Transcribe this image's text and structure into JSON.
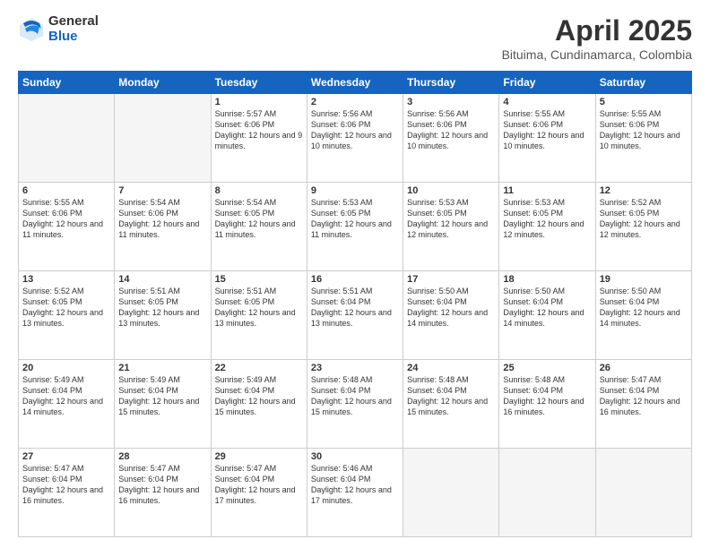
{
  "header": {
    "logo": {
      "general": "General",
      "blue": "Blue"
    },
    "title": "April 2025",
    "location": "Bituima, Cundinamarca, Colombia"
  },
  "weekdays": [
    "Sunday",
    "Monday",
    "Tuesday",
    "Wednesday",
    "Thursday",
    "Friday",
    "Saturday"
  ],
  "weeks": [
    [
      {
        "day": "",
        "empty": true
      },
      {
        "day": "",
        "empty": true
      },
      {
        "day": "1",
        "sunrise": "Sunrise: 5:57 AM",
        "sunset": "Sunset: 6:06 PM",
        "daylight": "Daylight: 12 hours and 9 minutes."
      },
      {
        "day": "2",
        "sunrise": "Sunrise: 5:56 AM",
        "sunset": "Sunset: 6:06 PM",
        "daylight": "Daylight: 12 hours and 10 minutes."
      },
      {
        "day": "3",
        "sunrise": "Sunrise: 5:56 AM",
        "sunset": "Sunset: 6:06 PM",
        "daylight": "Daylight: 12 hours and 10 minutes."
      },
      {
        "day": "4",
        "sunrise": "Sunrise: 5:55 AM",
        "sunset": "Sunset: 6:06 PM",
        "daylight": "Daylight: 12 hours and 10 minutes."
      },
      {
        "day": "5",
        "sunrise": "Sunrise: 5:55 AM",
        "sunset": "Sunset: 6:06 PM",
        "daylight": "Daylight: 12 hours and 10 minutes."
      }
    ],
    [
      {
        "day": "6",
        "sunrise": "Sunrise: 5:55 AM",
        "sunset": "Sunset: 6:06 PM",
        "daylight": "Daylight: 12 hours and 11 minutes."
      },
      {
        "day": "7",
        "sunrise": "Sunrise: 5:54 AM",
        "sunset": "Sunset: 6:06 PM",
        "daylight": "Daylight: 12 hours and 11 minutes."
      },
      {
        "day": "8",
        "sunrise": "Sunrise: 5:54 AM",
        "sunset": "Sunset: 6:05 PM",
        "daylight": "Daylight: 12 hours and 11 minutes."
      },
      {
        "day": "9",
        "sunrise": "Sunrise: 5:53 AM",
        "sunset": "Sunset: 6:05 PM",
        "daylight": "Daylight: 12 hours and 11 minutes."
      },
      {
        "day": "10",
        "sunrise": "Sunrise: 5:53 AM",
        "sunset": "Sunset: 6:05 PM",
        "daylight": "Daylight: 12 hours and 12 minutes."
      },
      {
        "day": "11",
        "sunrise": "Sunrise: 5:53 AM",
        "sunset": "Sunset: 6:05 PM",
        "daylight": "Daylight: 12 hours and 12 minutes."
      },
      {
        "day": "12",
        "sunrise": "Sunrise: 5:52 AM",
        "sunset": "Sunset: 6:05 PM",
        "daylight": "Daylight: 12 hours and 12 minutes."
      }
    ],
    [
      {
        "day": "13",
        "sunrise": "Sunrise: 5:52 AM",
        "sunset": "Sunset: 6:05 PM",
        "daylight": "Daylight: 12 hours and 13 minutes."
      },
      {
        "day": "14",
        "sunrise": "Sunrise: 5:51 AM",
        "sunset": "Sunset: 6:05 PM",
        "daylight": "Daylight: 12 hours and 13 minutes."
      },
      {
        "day": "15",
        "sunrise": "Sunrise: 5:51 AM",
        "sunset": "Sunset: 6:05 PM",
        "daylight": "Daylight: 12 hours and 13 minutes."
      },
      {
        "day": "16",
        "sunrise": "Sunrise: 5:51 AM",
        "sunset": "Sunset: 6:04 PM",
        "daylight": "Daylight: 12 hours and 13 minutes."
      },
      {
        "day": "17",
        "sunrise": "Sunrise: 5:50 AM",
        "sunset": "Sunset: 6:04 PM",
        "daylight": "Daylight: 12 hours and 14 minutes."
      },
      {
        "day": "18",
        "sunrise": "Sunrise: 5:50 AM",
        "sunset": "Sunset: 6:04 PM",
        "daylight": "Daylight: 12 hours and 14 minutes."
      },
      {
        "day": "19",
        "sunrise": "Sunrise: 5:50 AM",
        "sunset": "Sunset: 6:04 PM",
        "daylight": "Daylight: 12 hours and 14 minutes."
      }
    ],
    [
      {
        "day": "20",
        "sunrise": "Sunrise: 5:49 AM",
        "sunset": "Sunset: 6:04 PM",
        "daylight": "Daylight: 12 hours and 14 minutes."
      },
      {
        "day": "21",
        "sunrise": "Sunrise: 5:49 AM",
        "sunset": "Sunset: 6:04 PM",
        "daylight": "Daylight: 12 hours and 15 minutes."
      },
      {
        "day": "22",
        "sunrise": "Sunrise: 5:49 AM",
        "sunset": "Sunset: 6:04 PM",
        "daylight": "Daylight: 12 hours and 15 minutes."
      },
      {
        "day": "23",
        "sunrise": "Sunrise: 5:48 AM",
        "sunset": "Sunset: 6:04 PM",
        "daylight": "Daylight: 12 hours and 15 minutes."
      },
      {
        "day": "24",
        "sunrise": "Sunrise: 5:48 AM",
        "sunset": "Sunset: 6:04 PM",
        "daylight": "Daylight: 12 hours and 15 minutes."
      },
      {
        "day": "25",
        "sunrise": "Sunrise: 5:48 AM",
        "sunset": "Sunset: 6:04 PM",
        "daylight": "Daylight: 12 hours and 16 minutes."
      },
      {
        "day": "26",
        "sunrise": "Sunrise: 5:47 AM",
        "sunset": "Sunset: 6:04 PM",
        "daylight": "Daylight: 12 hours and 16 minutes."
      }
    ],
    [
      {
        "day": "27",
        "sunrise": "Sunrise: 5:47 AM",
        "sunset": "Sunset: 6:04 PM",
        "daylight": "Daylight: 12 hours and 16 minutes."
      },
      {
        "day": "28",
        "sunrise": "Sunrise: 5:47 AM",
        "sunset": "Sunset: 6:04 PM",
        "daylight": "Daylight: 12 hours and 16 minutes."
      },
      {
        "day": "29",
        "sunrise": "Sunrise: 5:47 AM",
        "sunset": "Sunset: 6:04 PM",
        "daylight": "Daylight: 12 hours and 17 minutes."
      },
      {
        "day": "30",
        "sunrise": "Sunrise: 5:46 AM",
        "sunset": "Sunset: 6:04 PM",
        "daylight": "Daylight: 12 hours and 17 minutes."
      },
      {
        "day": "",
        "empty": true
      },
      {
        "day": "",
        "empty": true
      },
      {
        "day": "",
        "empty": true
      }
    ]
  ]
}
